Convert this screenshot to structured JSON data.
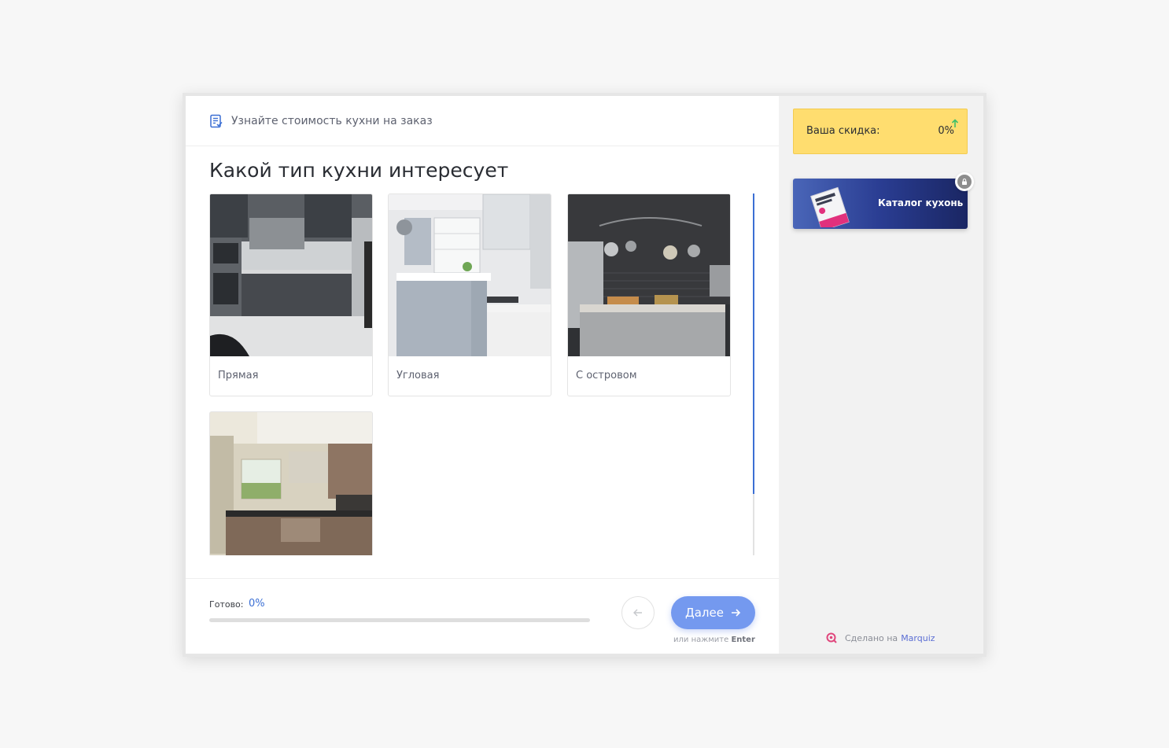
{
  "header": {
    "title": "Узнайте стоимость кухни на заказ",
    "icon": "list-doc-icon"
  },
  "question": {
    "title": "Какой тип кухни интересует"
  },
  "options": [
    {
      "label": "Прямая",
      "image": "kitchen-straight-photo"
    },
    {
      "label": "Угловая",
      "image": "kitchen-corner-photo"
    },
    {
      "label": "С островом",
      "image": "kitchen-island-photo"
    },
    {
      "label": "",
      "image": "kitchen-u-shape-photo"
    }
  ],
  "footer": {
    "progress_label": "Готово:",
    "progress_value": "0%",
    "progress_fraction": 0,
    "next_label": "Далее",
    "hint_prefix": "или нажмите",
    "hint_key": "Enter"
  },
  "sidebar": {
    "discount_label": "Ваша скидка:",
    "discount_value": "0%",
    "bonus_label": "Каталог кухонь",
    "made_with_prefix": "Сделано на",
    "made_with_brand": "Marquiz"
  },
  "colors": {
    "accent": "#3b6fd4",
    "next_button": "#7499ef",
    "discount_bg": "#ffdd6f"
  }
}
